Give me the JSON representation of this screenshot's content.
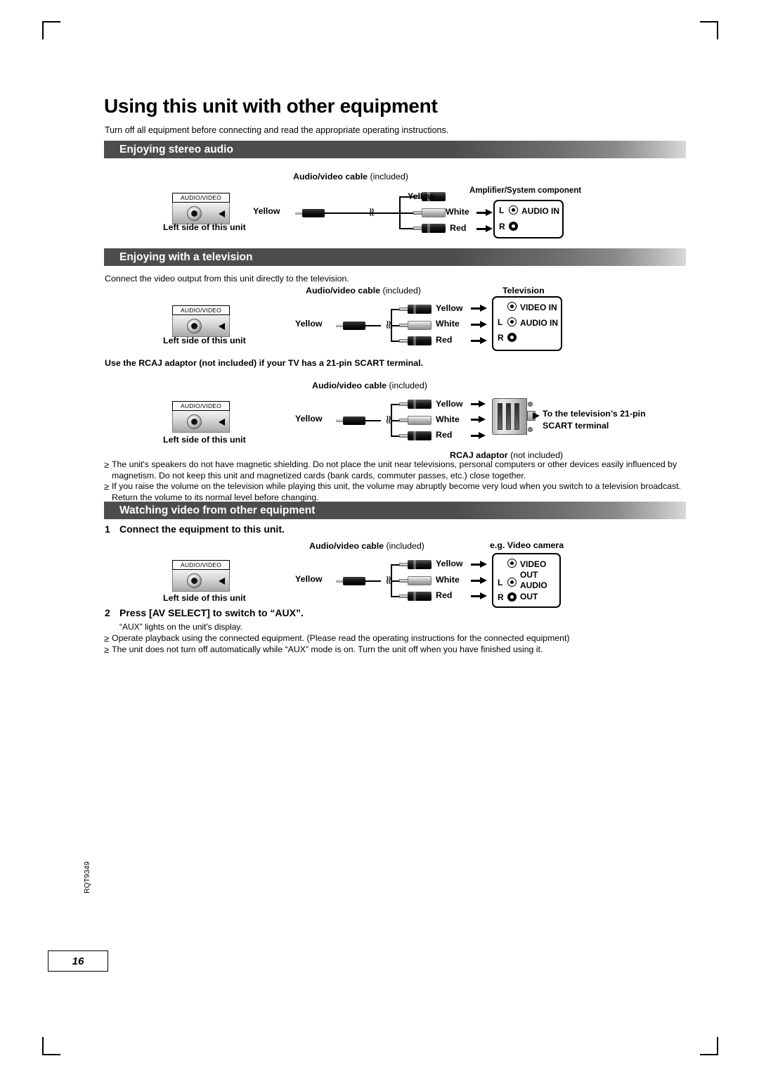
{
  "page": {
    "title": "Using this unit with other equipment",
    "intro": "Turn off all equipment before connecting and read the appropriate operating instructions.",
    "number": "16",
    "side_code": "RQT9349"
  },
  "sections": [
    {
      "id": "stereo",
      "heading": "Enjoying stereo audio",
      "cable_label_bold": "Audio/video cable",
      "cable_label_note": "(included)",
      "device_label": "Amplifier/System component",
      "unit_jack_caption": "AUDIO/VIDEO",
      "unit_side_label": "Left side of this unit",
      "plug_left_label": "Yellow",
      "plug_labels": [
        "Yellow",
        "White",
        "Red"
      ],
      "terminal": {
        "rows": [
          "L",
          "R"
        ],
        "label": "AUDIO IN"
      }
    },
    {
      "id": "television",
      "heading": "Enjoying with a television",
      "intro": "Connect the video output from this unit directly to the television.",
      "cable_label_bold": "Audio/video cable",
      "cable_label_note": "(included)",
      "device_label": "Television",
      "unit_jack_caption": "AUDIO/VIDEO",
      "unit_side_label": "Left side of this unit",
      "plug_left_label": "Yellow",
      "plug_labels": [
        "Yellow",
        "White",
        "Red"
      ],
      "terminal": {
        "video_in": "VIDEO IN",
        "rows": [
          "L",
          "R"
        ],
        "audio_in": "AUDIO IN"
      }
    },
    {
      "id": "scart",
      "note_bold": "Use the RCAJ adaptor (not included) if your TV has a 21-pin SCART terminal.",
      "cable_label_bold": "Audio/video cable",
      "cable_label_note": "(included)",
      "unit_jack_caption": "AUDIO/VIDEO",
      "unit_side_label": "Left side of this unit",
      "plug_left_label": "Yellow",
      "plug_labels": [
        "Yellow",
        "White",
        "Red"
      ],
      "target_line1": "To the television’s 21-pin",
      "target_line2": "SCART terminal",
      "adaptor_bold": "RCAJ adaptor",
      "adaptor_note": "(not included)"
    },
    {
      "id": "aux",
      "heading": "Watching video from other equipment",
      "step1_num": "1",
      "step1_text": "Connect the equipment to this unit.",
      "step2_num": "2",
      "step2_text": "Press [AV SELECT] to switch to “AUX”.",
      "step2_sub": "“AUX” lights on the unit's display.",
      "cable_label_bold": "Audio/video cable",
      "cable_label_note": "(included)",
      "device_label": "e.g. Video camera",
      "unit_jack_caption": "AUDIO/VIDEO",
      "unit_side_label": "Left side of this unit",
      "plug_left_label": "Yellow",
      "plug_labels": [
        "Yellow",
        "White",
        "Red"
      ],
      "terminal": {
        "video": "VIDEO",
        "out1": "OUT",
        "rows": [
          "L",
          "R"
        ],
        "audio": "AUDIO",
        "out2": "OUT"
      }
    }
  ],
  "bullets": {
    "tv": [
      "The unit's speakers do not have magnetic shielding. Do not place the unit near televisions, personal computers or other devices easily influenced by magnetism. Do not keep this unit and magnetized cards (bank cards, commuter passes, etc.) close together.",
      "If you raise the volume on the television while playing this unit, the volume may abruptly become very loud when you switch to a television broadcast. Return the volume to its normal level before changing."
    ],
    "aux": [
      "Operate playback using the connected equipment. (Please read the operating instructions for the connected equipment)",
      "The unit does not turn off automatically while “AUX” mode is on. Turn the unit off when you have finished using it."
    ]
  }
}
